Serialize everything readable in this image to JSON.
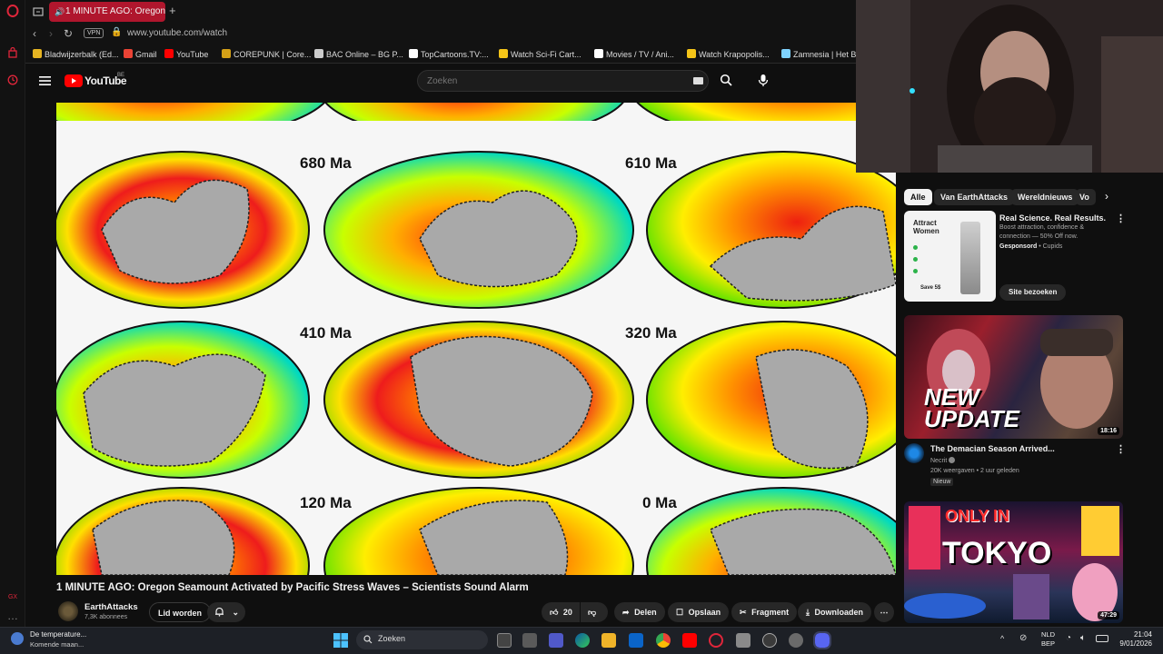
{
  "browser": {
    "active_tab_title": "1 MINUTE AGO: Oregon",
    "url": "www.youtube.com/watch",
    "vpn_label": "VPN",
    "bookmarks": [
      {
        "label": "Bladwijzerbalk (Ed...",
        "icon": "folder-icon",
        "color": "#e6b422"
      },
      {
        "label": "Gmail",
        "icon": "gmail-icon",
        "color": "#ea4335"
      },
      {
        "label": "YouTube",
        "icon": "youtube-icon",
        "color": "#ff0000"
      },
      {
        "label": "COREPUNK | Core...",
        "icon": "corepunk-icon",
        "color": "#d4a017"
      },
      {
        "label": "BAC Online – BG P...",
        "icon": "bac-icon",
        "color": "#cccccc"
      },
      {
        "label": "TopCartoons.TV:...",
        "icon": "topcartoons-icon",
        "color": "#ffffff"
      },
      {
        "label": "Watch Sci-Fi Cart...",
        "icon": "scifi-icon",
        "color": "#f5c518"
      },
      {
        "label": "Movies / TV / Ani...",
        "icon": "play-icon",
        "color": "#ffffff"
      },
      {
        "label": "Watch Krapopolis...",
        "icon": "krapopolis-icon",
        "color": "#f5c518"
      },
      {
        "label": "Zamnesia | Het Be",
        "icon": "zamnesia-icon",
        "color": "#7fd3ff"
      }
    ]
  },
  "youtube": {
    "logo_text": "YouTube",
    "region": "BE",
    "search_placeholder": "Zoeken"
  },
  "video": {
    "labels": [
      "680 Ma",
      "610 Ma",
      "410 Ma",
      "320 Ma",
      "120 Ma",
      "0 Ma"
    ],
    "title": "1 MINUTE AGO: Oregon Seamount Activated by Pacific Stress Waves – Scientists Sound Alarm",
    "channel": "EarthAttacks",
    "subscribers": "7,3K abonnees",
    "join_label": "Lid worden",
    "likes": "20",
    "share_label": "Delen",
    "save_label": "Opslaan",
    "clip_label": "Fragment",
    "download_label": "Downloaden"
  },
  "sidebar": {
    "chips": [
      "Alle",
      "Van EarthAttacks",
      "Wereldnieuws",
      "Vo"
    ],
    "ad": {
      "title": "Real Science. Real Results.",
      "desc_line1": "Boost attraction, confidence &",
      "desc_line2": "connection — 50% Off now.",
      "sponsored": "Gesponsord",
      "advertiser": "Cupids",
      "cta": "Site bezoeken",
      "thumb_heading1": "Attract",
      "thumb_heading2": "Women",
      "thumb_badge": "Save 5$"
    },
    "videos": [
      {
        "title": "The Demacian Season Arrived...",
        "channel": "Necrit",
        "stats": "20K weergaven • 2 uur geleden",
        "badge": "Nieuw",
        "duration": "18:16",
        "thumb_text1": "NEW",
        "thumb_text2": "UPDATE"
      },
      {
        "duration": "47:29",
        "thumb_text1": "ONLY IN",
        "thumb_text2": "TOKYO"
      }
    ]
  },
  "taskbar": {
    "weather_line1": "De temperature...",
    "weather_line2": "Komende maan...",
    "search_label": "Zoeken",
    "lang1": "NLD",
    "lang2": "BEP",
    "time": "21:04",
    "date": "9/01/2026"
  }
}
